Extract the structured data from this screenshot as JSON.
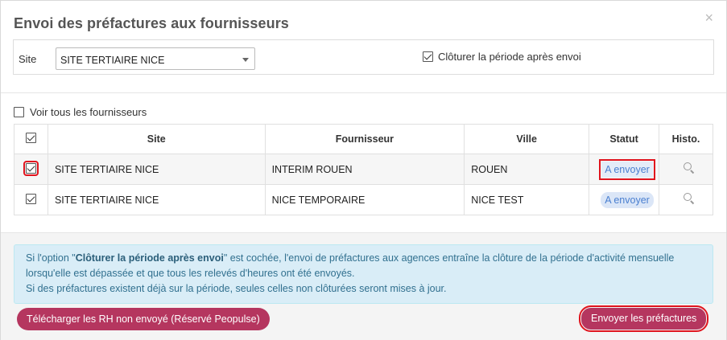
{
  "modal": {
    "title": "Envoi des préfactures aux fournisseurs",
    "close_glyph": "×"
  },
  "filters": {
    "site_label": "Site",
    "site_value": "SITE TERTIAIRE NICE",
    "close_period_label": "Clôturer la période après envoi",
    "close_period_checked": true
  },
  "see_all_label": "Voir tous les fournisseurs",
  "table": {
    "columns": [
      "Site",
      "Fournisseur",
      "Ville",
      "Statut",
      "Histo."
    ],
    "rows": [
      {
        "site": "SITE TERTIAIRE NICE",
        "fournisseur": "INTERIM ROUEN",
        "ville": "ROUEN",
        "statut": "A envoyer"
      },
      {
        "site": "SITE TERTIAIRE NICE",
        "fournisseur": "NICE TEMPORAIRE",
        "ville": "NICE TEST",
        "statut": "A envoyer"
      }
    ]
  },
  "info": {
    "prefix": "Si l'option \"",
    "option_name": "Clôturer la période après envoi",
    "suffix": "\" est cochée, l'envoi de préfactures aux agences entraîne la clôture de la période d'activité mensuelle",
    "line2": "lorsqu'elle est dépassée et que tous les relevés d'heures ont été envoyés.",
    "line3": "Si des préfactures existent déjà sur la période, seules celles non clôturées seront mises à jour."
  },
  "buttons": {
    "download_label": "Télécharger les RH non envoyé (Réservé Peopulse)",
    "send_label": "Envoyer les préfactures"
  },
  "colors": {
    "primary_button": "#b5365f",
    "badge_bg": "#dbe6f7",
    "badge_text": "#4a7fd0",
    "info_bg": "#d9edf7",
    "highlight": "#e0141e"
  }
}
